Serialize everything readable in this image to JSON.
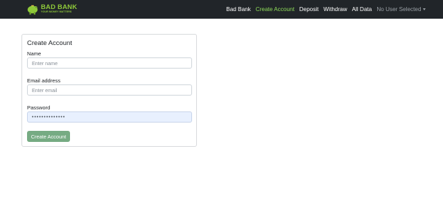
{
  "brand": {
    "name": "BAD BANK",
    "tagline": "YOUR MONEY MATTERS",
    "logo_icon": "piggy-bank-icon"
  },
  "nav": {
    "items": [
      "Bad Bank",
      "Create Account",
      "Deposit",
      "Withdraw",
      "All Data"
    ],
    "active": "Create Account",
    "user_dropdown": "No User Selected"
  },
  "form": {
    "title": "Create Account",
    "name_label": "Name",
    "name_placeholder": "Enter name",
    "email_label": "Email address",
    "email_placeholder": "Enter email",
    "password_label": "Password",
    "password_value": "••••••••••••••",
    "submit_label": "Create Account"
  },
  "colors": {
    "navbar": "#212529",
    "brand": "#8fc93a",
    "active_link": "#8fdc5a",
    "button": "#76ab83",
    "autofill": "#e8f0fe"
  }
}
